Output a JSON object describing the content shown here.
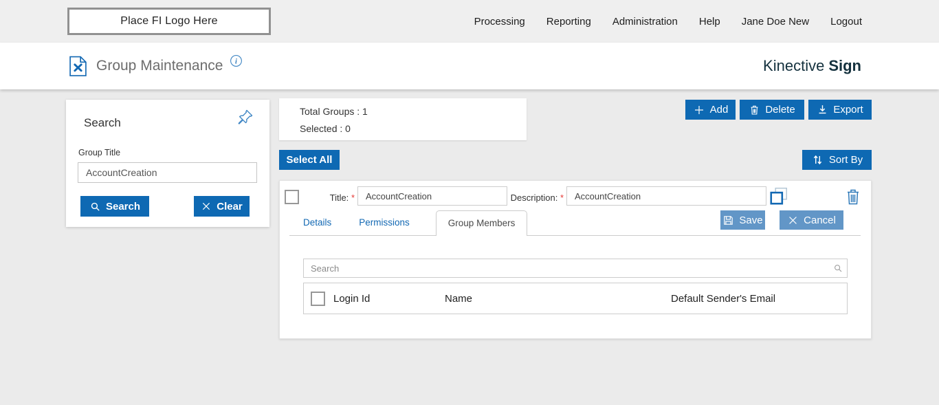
{
  "topbar": {
    "logo": "Place FI Logo Here",
    "nav": [
      "Processing",
      "Reporting",
      "Administration",
      "Help",
      "Jane Doe New",
      "Logout"
    ]
  },
  "header": {
    "page_title": "Group Maintenance",
    "brand_name": "Kinective",
    "brand_suffix": "Sign"
  },
  "search_panel": {
    "title": "Search",
    "field_label": "Group Title",
    "field_value": "AccountCreation",
    "search_button": "Search",
    "clear_button": "Clear"
  },
  "summary": {
    "total_groups": "Total Groups : 1",
    "selected": "Selected : 0"
  },
  "actions": {
    "add": "Add",
    "delete": "Delete",
    "export": "Export",
    "select_all": "Select All",
    "sort_by": "Sort By"
  },
  "group_editor": {
    "title_label": "Title:",
    "description_label": "Description:",
    "required_marker": "*",
    "title_value": "AccountCreation",
    "description_value": "AccountCreation",
    "tabs": [
      "Details",
      "Permissions",
      "Group Members"
    ],
    "active_tab": "Group Members",
    "save_button": "Save",
    "cancel_button": "Cancel",
    "members": {
      "search_placeholder": "Search",
      "columns": [
        "Login Id",
        "Name",
        "Default Sender's Email"
      ],
      "rows": []
    }
  },
  "colors": {
    "primary_blue": "#0e69b3",
    "secondary_blue": "#6296c7",
    "link_blue": "#1268b3",
    "icon_blue": "#2e79b9",
    "brand_dark": "#14313e",
    "topbar_gray": "#efefef",
    "page_bg": "#ebebeb"
  }
}
